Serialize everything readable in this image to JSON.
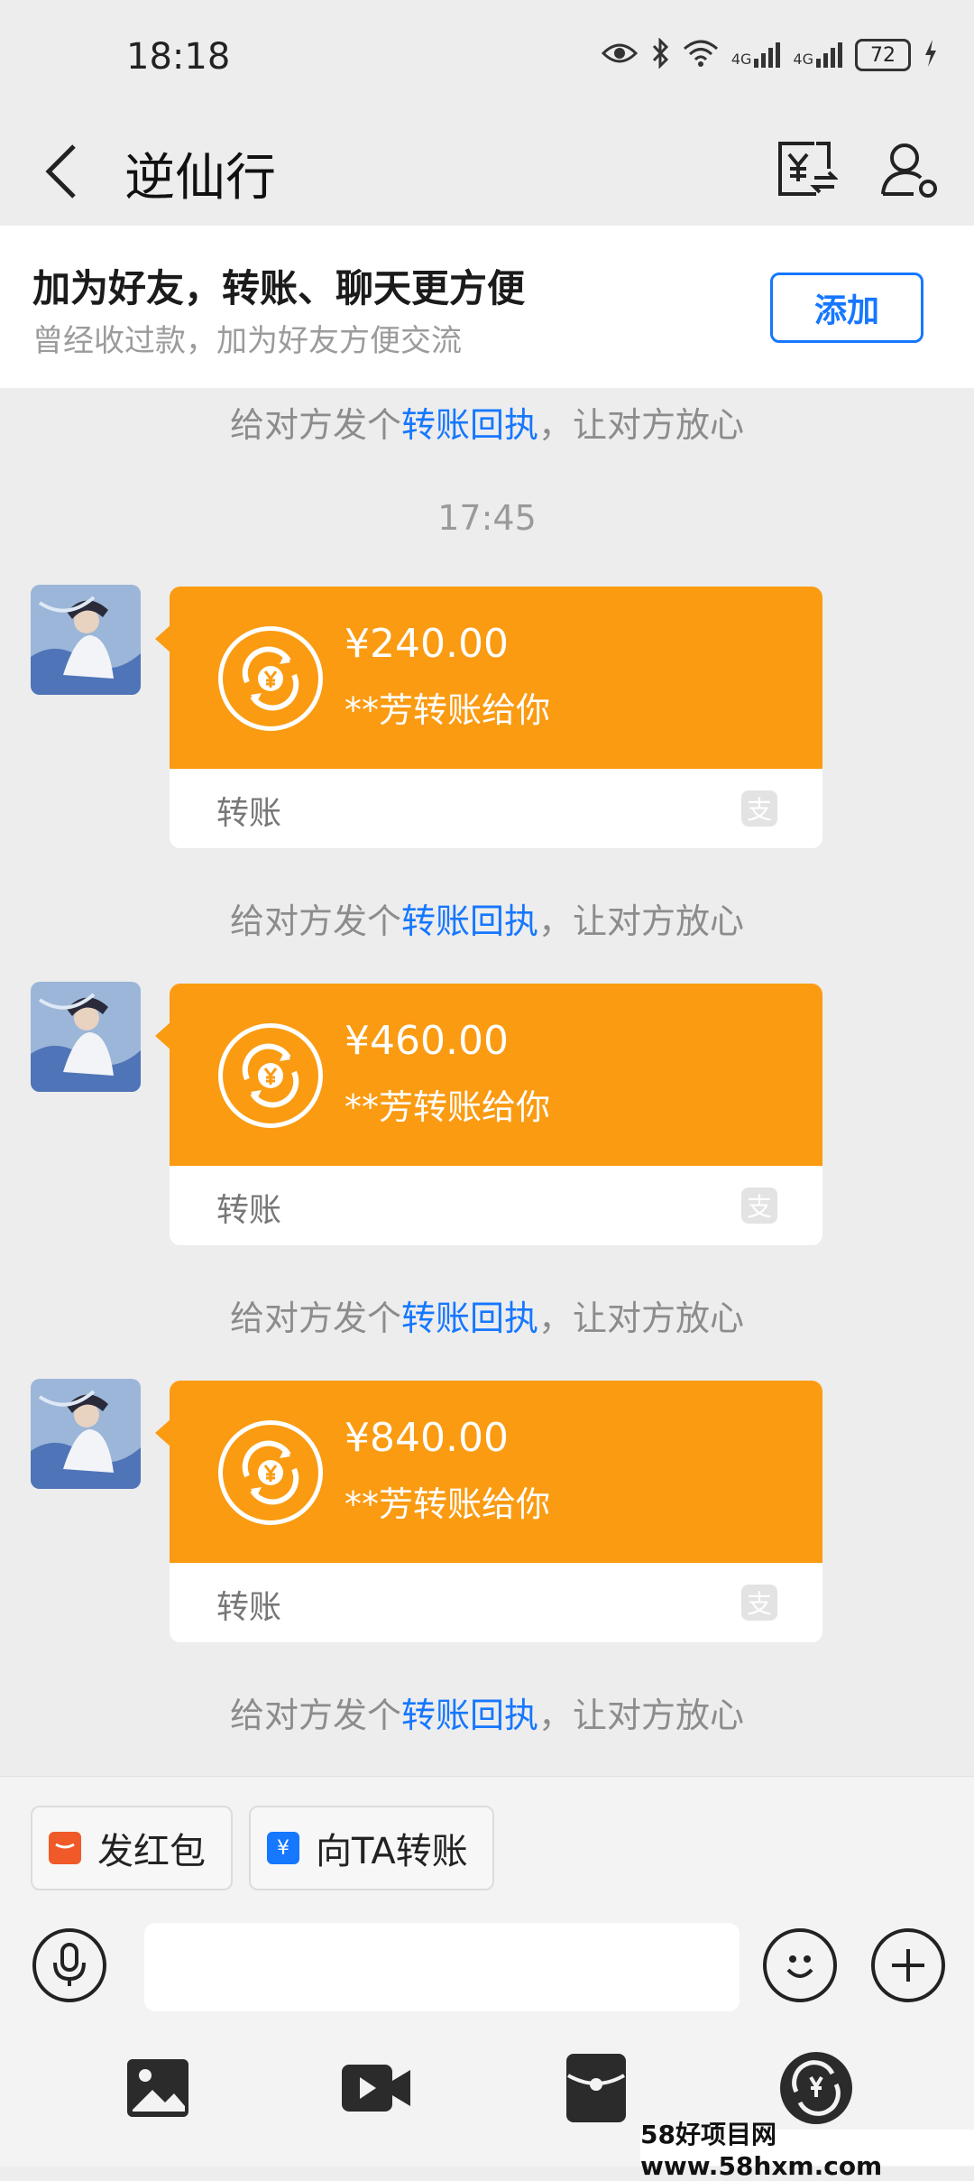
{
  "status_bar": {
    "time": "18:18",
    "battery": "72",
    "network1": "4G",
    "network2": "4G"
  },
  "header": {
    "title": "逆仙行"
  },
  "add_friend": {
    "title": "加为好友，转账、聊天更方便",
    "subtitle": "曾经收过款，加为好友方便交流",
    "button": "添加"
  },
  "receipt_prompt": {
    "prefix": "给对方发个",
    "link": "转账回执",
    "suffix": "，让对方放心"
  },
  "timestamp": "17:45",
  "transfers": [
    {
      "amount": "¥240.00",
      "from": "**芳转账给你",
      "label": "转账"
    },
    {
      "amount": "¥460.00",
      "from": "**芳转账给你",
      "label": "转账"
    },
    {
      "amount": "¥840.00",
      "from": "**芳转账给你",
      "label": "转账"
    }
  ],
  "quick_actions": {
    "red_packet": "发红包",
    "transfer": "向TA转账"
  },
  "input": {
    "placeholder": ""
  },
  "watermark": "58好项目网www.58hxm.com",
  "colors": {
    "card": "#fa9b12",
    "link": "#1677ff",
    "red_packet": "#f05a28",
    "transfer_icon": "#1677ff"
  }
}
